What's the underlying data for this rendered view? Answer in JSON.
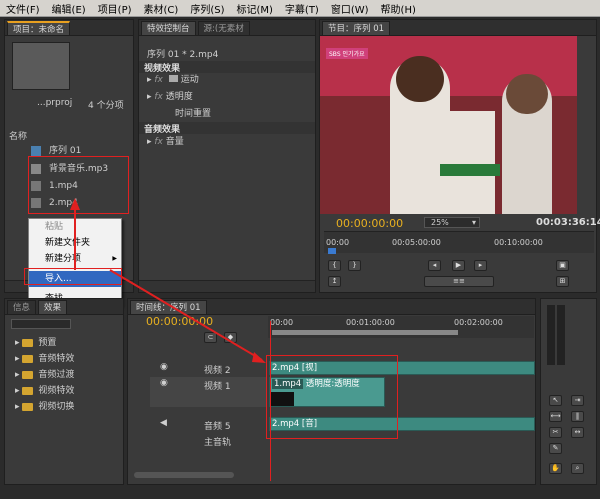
{
  "menu": [
    "文件(F)",
    "编辑(E)",
    "项目(P)",
    "素材(C)",
    "序列(S)",
    "标记(M)",
    "字幕(T)",
    "窗口(W)",
    "帮助(H)"
  ],
  "project": {
    "tab": "项目：未命名",
    "file_name": "...prproj",
    "count": "4 个分项",
    "col_name": "名称",
    "items": [
      "序列 01",
      "背景音乐.mp3",
      "1.mp4",
      "2.mp4"
    ]
  },
  "context_menu": {
    "items": [
      "粘贴",
      "新建文件夹",
      "新建分项",
      "导入...",
      "查找..."
    ],
    "submenu_arrow": "▶"
  },
  "effects_control": {
    "tabs": [
      "特效控制台",
      "源:(无素材"
    ],
    "seq_label": "序列 01 * 2.mp4",
    "video_header": "视频效果",
    "video_items": [
      "运动",
      "透明度",
      "时间重置"
    ],
    "audio_header": "音频效果",
    "audio_items": [
      "音量"
    ],
    "fx": "fx"
  },
  "program": {
    "tab": "节目：序列 01",
    "timecode_left": "00:00:00:00",
    "zoom": "25%",
    "timecode_right": "00:03:36:14",
    "ruler": [
      "00:00",
      "00:05:00:00",
      "00:10:00:00"
    ],
    "overlay_text": "SBS 인기가요"
  },
  "effects_panel": {
    "tabs": [
      "信息",
      "效果"
    ],
    "folders": [
      "预置",
      "音频特效",
      "音频过渡",
      "视频特效",
      "视频切换"
    ]
  },
  "timeline": {
    "tab": "时间线：序列 01",
    "timecode": "00:00:00:00",
    "ruler": [
      "00:00",
      "00:01:00:00",
      "00:02:00:00"
    ],
    "tracks": [
      "视频 2",
      "视频 1",
      "音频 5",
      "主音轨"
    ],
    "clip_v2": "2.mp4 [视]",
    "clip_v1": "1.mp4",
    "clip_v1_prop": "透明度:透明度",
    "clip_a5": "2.mp4 [音]"
  },
  "colors": {
    "accent": "#e8a020",
    "timecode": "#e8b020",
    "clip": "#3d8a80",
    "arrow": "#e02020"
  }
}
